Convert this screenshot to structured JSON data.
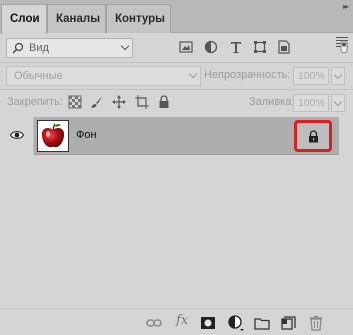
{
  "tabs": {
    "layers": "Слои",
    "channels": "Каналы",
    "paths": "Контуры"
  },
  "filter": {
    "kind": "Вид",
    "icons": [
      "image-filter-icon",
      "adjustment-filter-icon",
      "type-filter-icon",
      "shape-filter-icon",
      "smart-object-filter-icon",
      "filter-toggle-icon"
    ]
  },
  "blend": {
    "mode": "Обычные",
    "opacity_label": "Непрозрачность:",
    "opacity_value": "100%",
    "fill_label": "Заливка:",
    "fill_value": "100%"
  },
  "lock": {
    "label": "Закрепить:",
    "icons": [
      "lock-transparent-pixels-icon",
      "lock-image-pixels-icon",
      "lock-position-icon",
      "lock-artboard-icon",
      "lock-all-icon"
    ]
  },
  "layers": [
    {
      "name": "Фон",
      "visible": true,
      "locked": true,
      "thumbnail": "red-apple-thumbnail",
      "highlight_color": "#dd1e1e"
    }
  ],
  "bottom_icons": [
    "link-layers-icon",
    "fx-icon",
    "add-mask-icon",
    "adjustment-layer-icon",
    "new-group-icon",
    "new-layer-icon",
    "delete-icon"
  ],
  "bottom_fx_label": "fx"
}
